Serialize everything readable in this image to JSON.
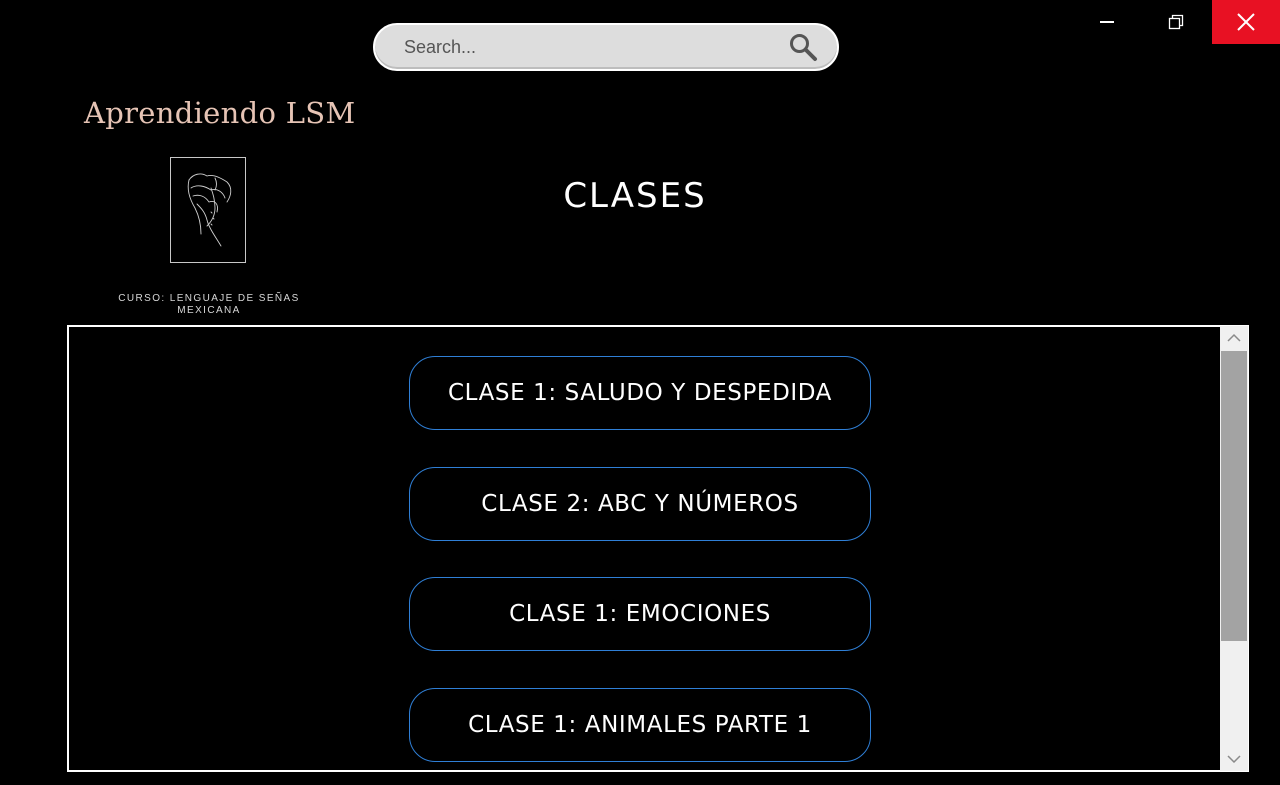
{
  "window": {
    "controls": [
      "minimize",
      "restore",
      "close"
    ],
    "close_color": "#e81123"
  },
  "search": {
    "placeholder": "Search...",
    "icon": "search-icon"
  },
  "brand": {
    "title": "Aprendiendo LSM",
    "subtitle_line1": "CURSO: LENGUAJE DE SEÑAS",
    "subtitle_line2": "MEXICANA",
    "logo_icon": "hand-sign-icon",
    "title_color": "#e6c4b5"
  },
  "page": {
    "title": "CLASES"
  },
  "classes": [
    {
      "label": "CLASE 1: SALUDO Y DESPEDIDA"
    },
    {
      "label": "CLASE 2: ABC Y NÚMEROS"
    },
    {
      "label": "CLASE 1: EMOCIONES"
    },
    {
      "label": "CLASE 1: ANIMALES PARTE 1"
    }
  ],
  "colors": {
    "background": "#000000",
    "button_border": "#2f7fd6",
    "panel_border": "#ffffff"
  }
}
